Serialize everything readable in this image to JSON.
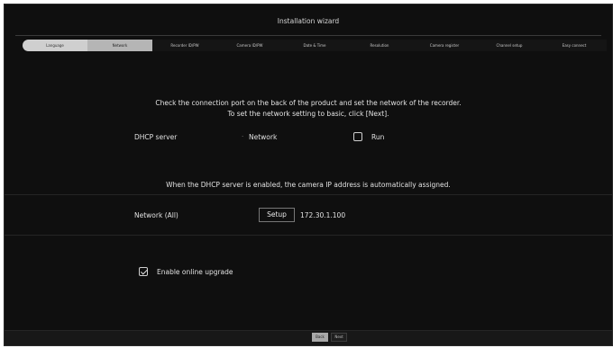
{
  "window": {
    "title": "Installation wizard"
  },
  "steps": [
    {
      "label": "Language",
      "state": "done"
    },
    {
      "label": "Network",
      "state": "current"
    },
    {
      "label": "Recorder ID/PW",
      "state": "todo"
    },
    {
      "label": "Camera ID/PW",
      "state": "todo"
    },
    {
      "label": "Date & Time",
      "state": "todo"
    },
    {
      "label": "Resolution",
      "state": "todo"
    },
    {
      "label": "Camera register",
      "state": "todo"
    },
    {
      "label": "Channel setup",
      "state": "todo"
    },
    {
      "label": "Easy connect",
      "state": "todo"
    }
  ],
  "main": {
    "instruction_line1": "Check the connection port on the back of the product and set the network of the recorder.",
    "instruction_line2": "To set the network setting to basic, click [Next].",
    "dhcp": {
      "label": "DHCP server",
      "option_label": "Network",
      "run_label": "Run",
      "run_checked": false
    },
    "dhcp_note": "When the DHCP server is enabled, the camera IP address is automatically assigned.",
    "network_all": {
      "label": "Network (All)",
      "setup_label": "Setup",
      "ip": "172.30.1.100"
    },
    "online_upgrade": {
      "label": "Enable online upgrade",
      "checked": true
    }
  },
  "footer": {
    "back_label": "Back",
    "next_label": "Next"
  },
  "colors": {
    "background": "#0f0f0f",
    "text": "#e2e2e2",
    "step_done": "#cfcfcf",
    "step_current": "#b5b5b5"
  }
}
